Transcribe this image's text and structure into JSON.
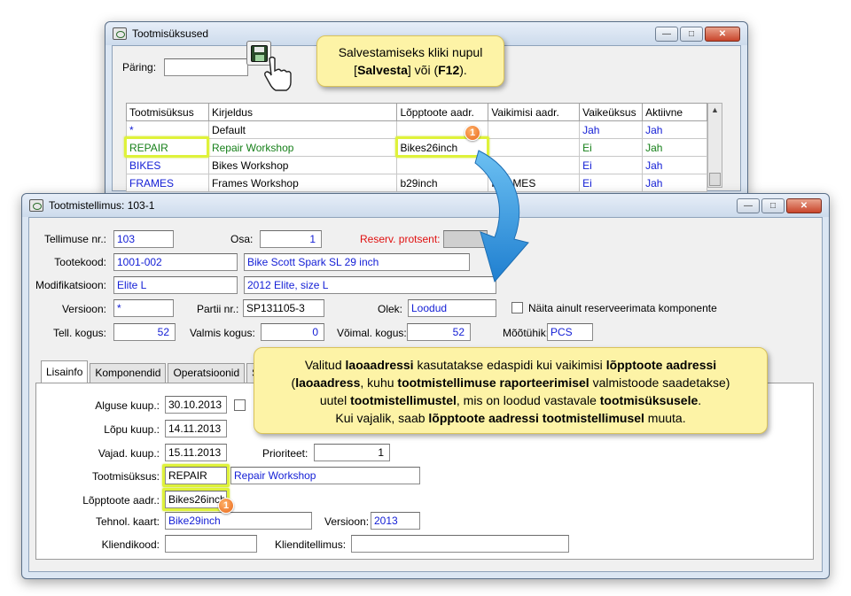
{
  "window1": {
    "title": "Tootmisüksused",
    "query_label": "Päring:",
    "query_value": "",
    "columns": [
      "Tootmisüksus",
      "Kirjeldus",
      "Lõpptoote aadr.",
      "Vaikimisi aadr.",
      "Vaikeüksus",
      "Aktiivne"
    ],
    "rows": [
      {
        "unit": "*",
        "desc": "Default",
        "endaddr": "",
        "defaddr": "",
        "defunit": "Jah",
        "active": "Jah"
      },
      {
        "unit": "REPAIR",
        "desc": "Repair Workshop",
        "endaddr": "Bikes26inch",
        "defaddr": "",
        "defunit": "Ei",
        "active": "Jah"
      },
      {
        "unit": "BIKES",
        "desc": "Bikes Workshop",
        "endaddr": "",
        "defaddr": "",
        "defunit": "Ei",
        "active": "Jah"
      },
      {
        "unit": "FRAMES",
        "desc": "Frames Workshop",
        "endaddr": "b29inch",
        "defaddr": "FRAMES",
        "defunit": "Ei",
        "active": "Jah"
      }
    ]
  },
  "callout_top": {
    "line1": "Salvestamiseks kliki nupul",
    "line2_pre": "[",
    "line2_bold1": "Salvesta",
    "line2_mid": "] või (",
    "line2_bold2": "F12",
    "line2_post": ")."
  },
  "callout_bottom": {
    "l1_a": "Valitud ",
    "l1_b": "laoaadressi",
    "l1_c": " kasutatakse edaspidi kui vaikimisi ",
    "l1_d": "lõpptoote aadressi",
    "l2_a": "(",
    "l2_b": "laoaadress",
    "l2_c": ", kuhu ",
    "l2_d": "tootmistellimuse raporteerimisel",
    "l2_e": " valmistoode saadetakse)",
    "l3_a": "uutel ",
    "l3_b": "tootmistellimustel",
    "l3_c": ", mis on loodud vastavale ",
    "l3_d": "tootmisüksusele",
    "l3_e": ".",
    "l4_a": "Kui vajalik, saab ",
    "l4_b": "lõpptoote aadressi tootmistellimusel",
    "l4_c": " muuta."
  },
  "badge_number": "1",
  "window2": {
    "title": "Tootmistellimus: 103-1",
    "labels": {
      "order_no": "Tellimuse nr.:",
      "part": "Osa:",
      "reserv": "Reserv. protsent:",
      "item_code": "Tootekood:",
      "modification": "Modifikatsioon:",
      "version": "Versioon:",
      "batch": "Partii nr.:",
      "status": "Olek:",
      "show_unreserved": "Näita ainult reserveerimata komponente",
      "order_qty": "Tell. kogus:",
      "done_qty": "Valmis kogus:",
      "possible_qty": "Võimal. kogus:",
      "unit": "Mõõtühik:"
    },
    "values": {
      "order_no": "103",
      "part": "1",
      "item_code": "1001-002",
      "item_name": "Bike Scott Spark SL 29 inch",
      "modification": "Elite L",
      "modification_name": "2012 Elite, size L",
      "version": "*",
      "batch": "SP131105-3",
      "status": "Loodud",
      "order_qty": "52",
      "done_qty": "0",
      "possible_qty": "52",
      "unit": "PCS"
    },
    "tabs": [
      "Lisainfo",
      "Komponendid",
      "Operatsioonid",
      "Se"
    ],
    "tab_labels": {
      "start_date": "Alguse kuup.:",
      "end_date": "Lõpu kuup.:",
      "need_date": "Vajad. kuup.:",
      "priority": "Prioriteet:",
      "prod_unit": "Tootmisüksus:",
      "end_addr": "Lõpptoote aadr.:",
      "tech_card": "Tehnol. kaart:",
      "version": "Versioon:",
      "customer_code": "Kliendikood:",
      "customer_order": "Klienditellimus:"
    },
    "tab_values": {
      "start_date": "30.10.2013",
      "end_date": "14.11.2013",
      "need_date": "15.11.2013",
      "priority": "1",
      "prod_unit": "REPAIR",
      "prod_unit_name": "Repair Workshop",
      "end_addr": "Bikes26inch",
      "tech_card": "Bike29inch",
      "version": "2013",
      "customer_code": "",
      "customer_order": ""
    }
  },
  "colors": {
    "highlight": "#dff23a",
    "callout_bg": "#fdf3a6",
    "badge": "#e8661a",
    "arrow": "#2f8fdc",
    "link_blue": "#1520d6",
    "green_row": "#17801a"
  }
}
